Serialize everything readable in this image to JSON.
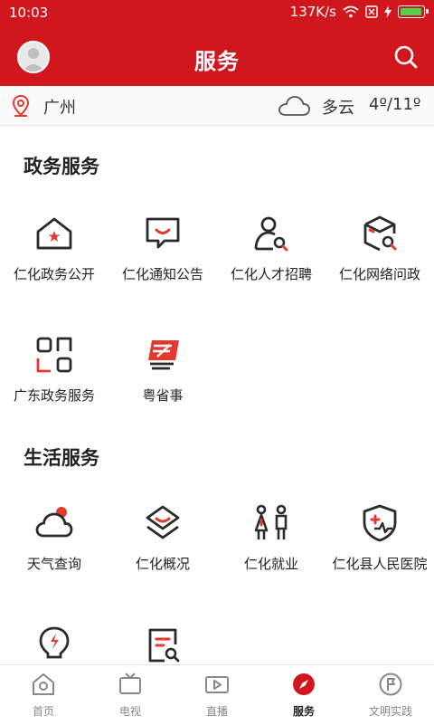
{
  "status": {
    "time": "10:03",
    "speed": "137K/s",
    "battery_level": 0.95
  },
  "header": {
    "title": "服务",
    "avatar_icon": "avatar-icon",
    "search_icon": "search-icon"
  },
  "weather": {
    "city": "广州",
    "desc": "多云",
    "temp": "4º/11º",
    "icon": "cloud-icon"
  },
  "gov_section": {
    "title": "政务服务",
    "items": [
      {
        "label": "仁化政务公开",
        "icon": "gov-building-icon"
      },
      {
        "label": "仁化通知公告",
        "icon": "message-icon"
      },
      {
        "label": "仁化人才招聘",
        "icon": "person-search-icon"
      },
      {
        "label": "仁化网络问政",
        "icon": "box-search-icon"
      },
      {
        "label": "广东政务服务",
        "icon": "apps-grid-icon"
      },
      {
        "label": "粤省事",
        "icon": "yue-logo-icon"
      }
    ]
  },
  "life_section": {
    "title": "生活服务",
    "items": [
      {
        "label": "天气查询",
        "icon": "weather-cloud-icon"
      },
      {
        "label": "仁化概况",
        "icon": "layers-icon"
      },
      {
        "label": "仁化就业",
        "icon": "people-icon"
      },
      {
        "label": "仁化县人民医院",
        "icon": "hospital-shield-icon"
      },
      {
        "label": "",
        "icon": "bulb-icon"
      },
      {
        "label": "",
        "icon": "doc-search-icon"
      }
    ]
  },
  "nav": {
    "items": [
      {
        "label": "首页",
        "icon": "home-icon"
      },
      {
        "label": "电视",
        "icon": "tv-icon"
      },
      {
        "label": "直播",
        "icon": "live-icon"
      },
      {
        "label": "服务",
        "icon": "compass-icon",
        "active": true
      },
      {
        "label": "文明实践",
        "icon": "flag-icon"
      }
    ]
  },
  "colors": {
    "brand": "#d0171d",
    "accent": "#e23a2e"
  }
}
